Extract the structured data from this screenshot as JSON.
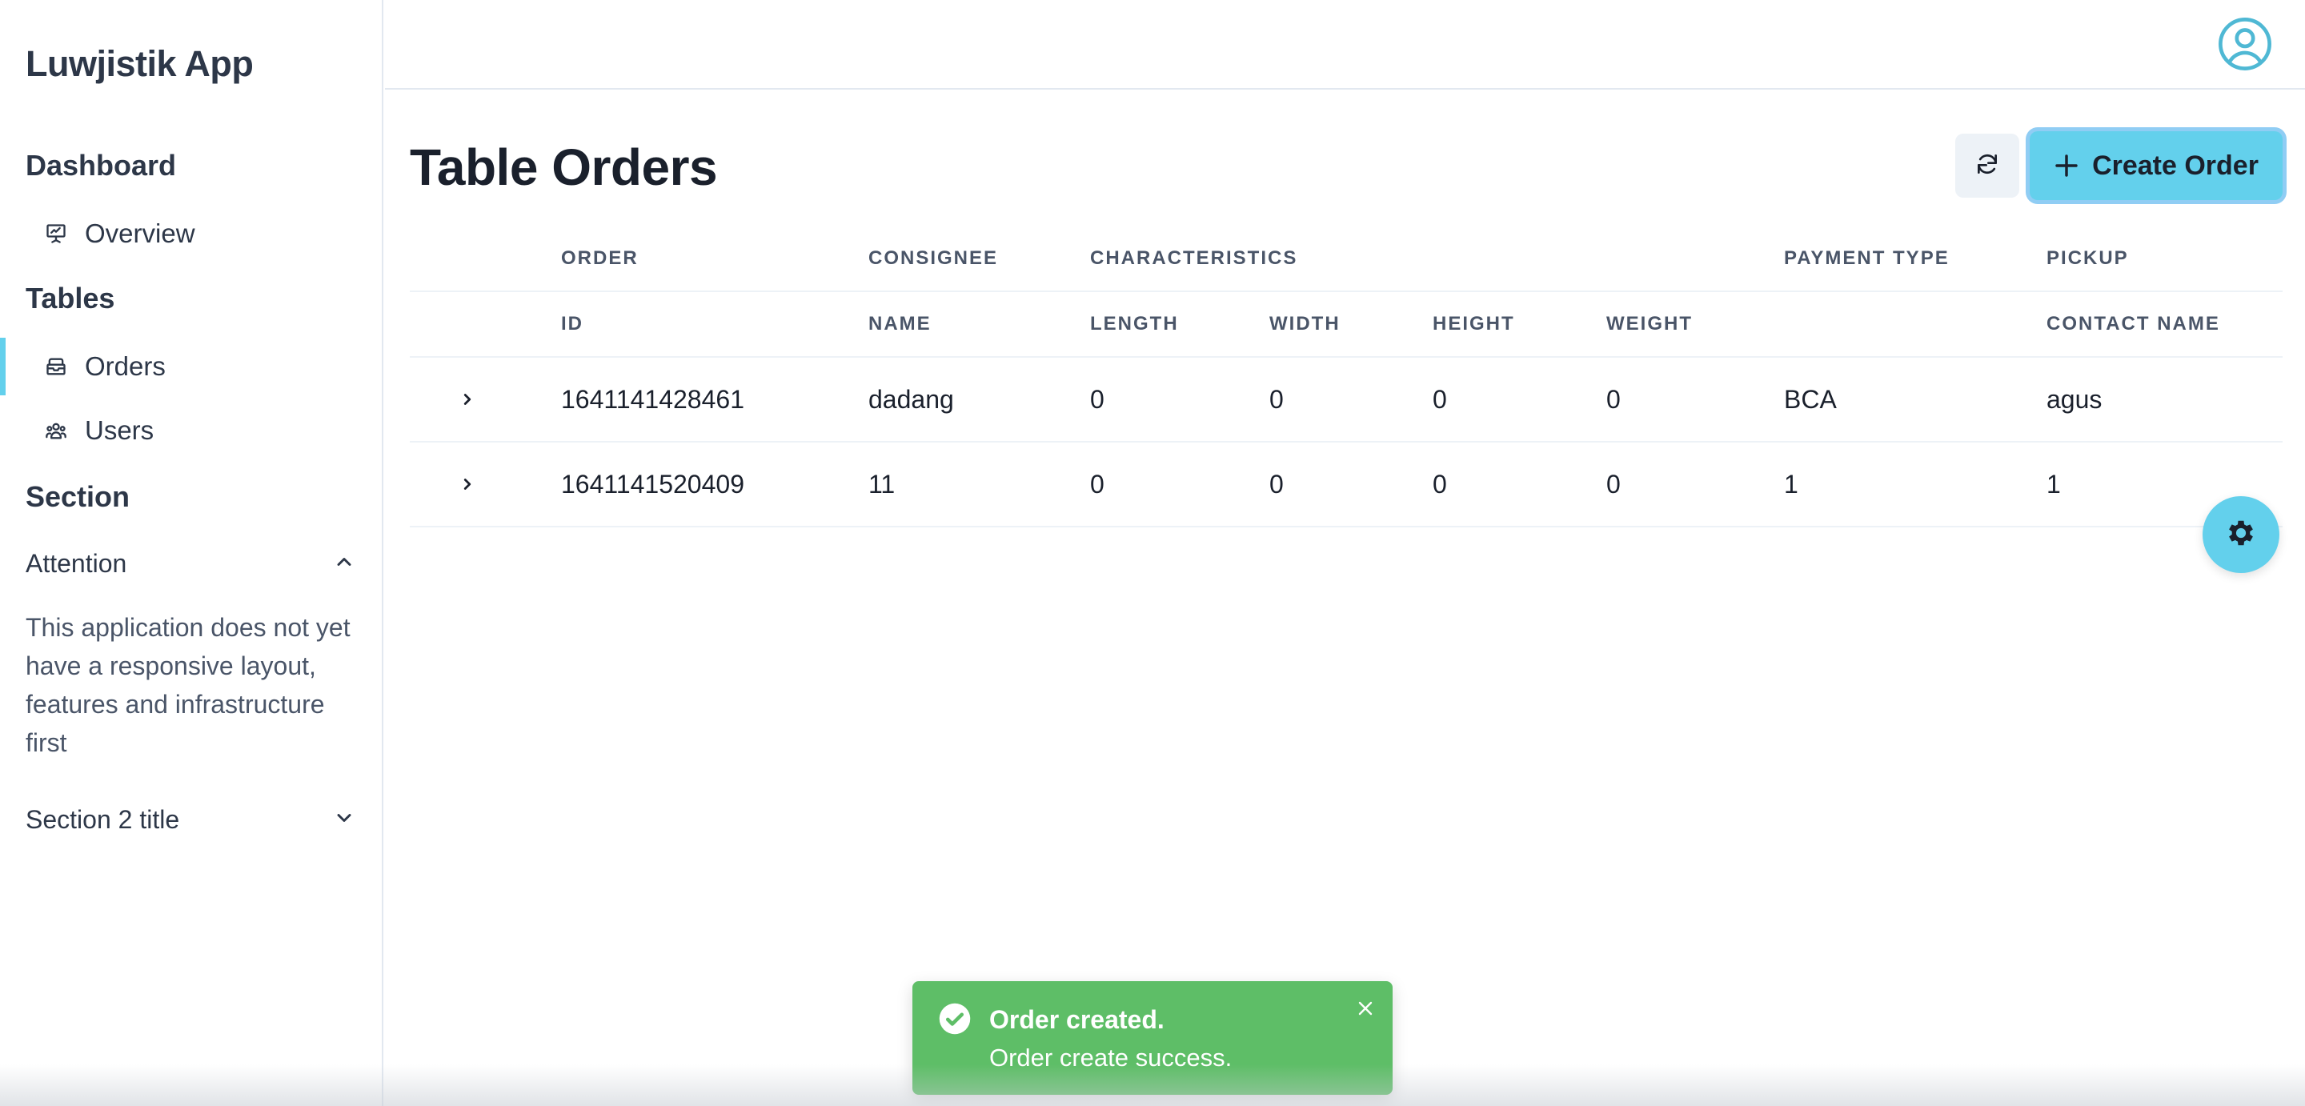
{
  "app": {
    "brand": "Luwjistik App"
  },
  "sidebar": {
    "groups": [
      {
        "title": "Dashboard",
        "items": [
          {
            "label": "Overview",
            "icon": "presentation-icon"
          }
        ]
      },
      {
        "title": "Tables",
        "items": [
          {
            "label": "Orders",
            "icon": "inbox-icon",
            "active": true
          },
          {
            "label": "Users",
            "icon": "users-icon"
          }
        ]
      },
      {
        "title": "Section"
      }
    ],
    "accordion": [
      {
        "label": "Attention",
        "expanded": true,
        "text": "This application does not yet have a responsive layout, features and infrastructure first"
      },
      {
        "label": "Section 2 title",
        "expanded": false
      }
    ]
  },
  "header": {
    "avatar_icon": "user-circle-icon"
  },
  "main": {
    "title": "Table Orders",
    "refresh_icon": "refresh-icon",
    "create_button": "Create Order"
  },
  "table": {
    "group_headers": [
      "ORDER",
      "CONSIGNEE",
      "CHARACTERISTICS",
      "PAYMENT TYPE",
      "PICKUP"
    ],
    "columns": [
      "ID",
      "NAME",
      "LENGTH",
      "WIDTH",
      "HEIGHT",
      "WEIGHT",
      "",
      "CONTACT NAME"
    ],
    "rows": [
      [
        "1641141428461",
        "dadang",
        "0",
        "0",
        "0",
        "0",
        "BCA",
        "agus"
      ],
      [
        "1641141520409",
        "11",
        "0",
        "0",
        "0",
        "0",
        "1",
        "1"
      ]
    ]
  },
  "fab": {
    "icon": "gear-icon"
  },
  "toast": {
    "title": "Order created.",
    "description": "Order create success.",
    "status": "success"
  },
  "colors": {
    "accent": "#63d0ec",
    "toast_success": "#5ebe67",
    "text": "#2d3748"
  }
}
